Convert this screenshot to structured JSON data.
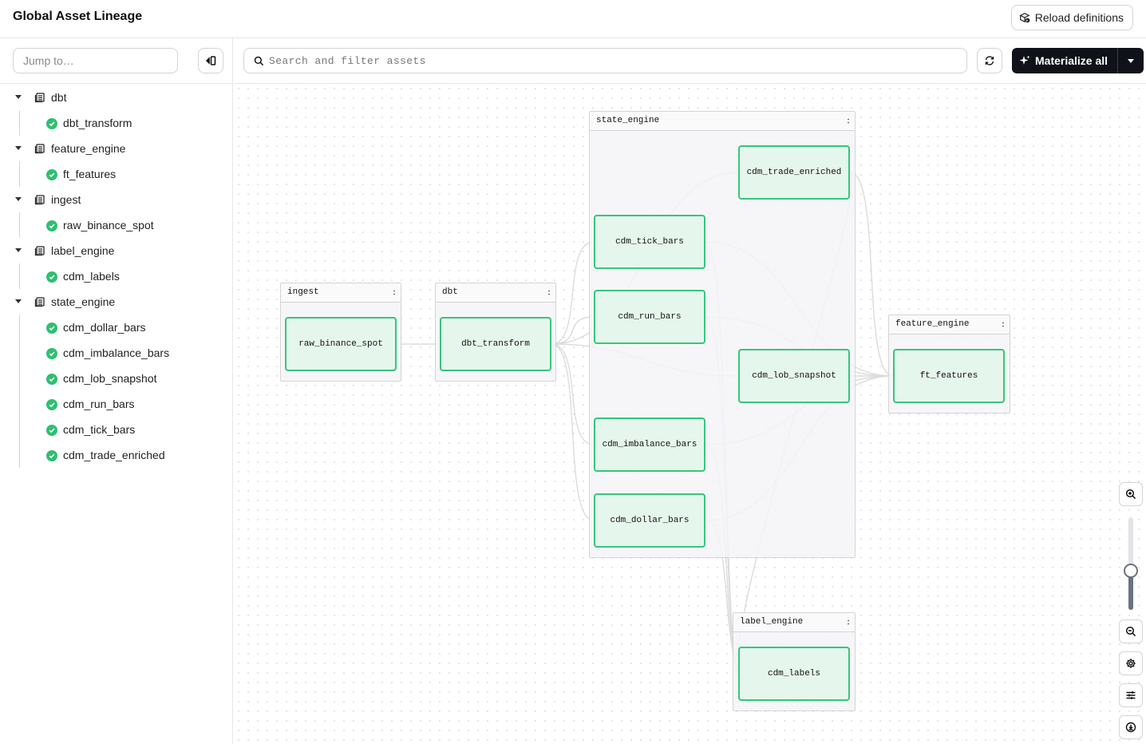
{
  "header": {
    "title": "Global Asset Lineage",
    "reload_label": "Reload definitions"
  },
  "sidebar": {
    "jump_placeholder": "Jump to…",
    "groups": [
      {
        "label": "dbt",
        "children": [
          "dbt_transform"
        ]
      },
      {
        "label": "feature_engine",
        "children": [
          "ft_features"
        ]
      },
      {
        "label": "ingest",
        "children": [
          "raw_binance_spot"
        ]
      },
      {
        "label": "label_engine",
        "children": [
          "cdm_labels"
        ]
      },
      {
        "label": "state_engine",
        "children": [
          "cdm_dollar_bars",
          "cdm_imbalance_bars",
          "cdm_lob_snapshot",
          "cdm_run_bars",
          "cdm_tick_bars",
          "cdm_trade_enriched"
        ]
      }
    ]
  },
  "toolbar": {
    "search_placeholder": "Search and filter assets",
    "materialize_label": "Materialize all"
  },
  "graph": {
    "groups": {
      "ingest": "ingest",
      "dbt": "dbt",
      "state_engine": "state_engine",
      "feature_engine": "feature_engine",
      "label_engine": "label_engine"
    },
    "assets": {
      "raw_binance_spot": "raw_binance_spot",
      "dbt_transform": "dbt_transform",
      "cdm_trade_enriched": "cdm_trade_enriched",
      "cdm_tick_bars": "cdm_tick_bars",
      "cdm_run_bars": "cdm_run_bars",
      "cdm_lob_snapshot": "cdm_lob_snapshot",
      "cdm_imbalance_bars": "cdm_imbalance_bars",
      "cdm_dollar_bars": "cdm_dollar_bars",
      "ft_features": "ft_features",
      "cdm_labels": "cdm_labels"
    },
    "status_color": "#35c67c",
    "edge_color": "#dcdcdf"
  },
  "zoom": {
    "level": 0.42
  }
}
